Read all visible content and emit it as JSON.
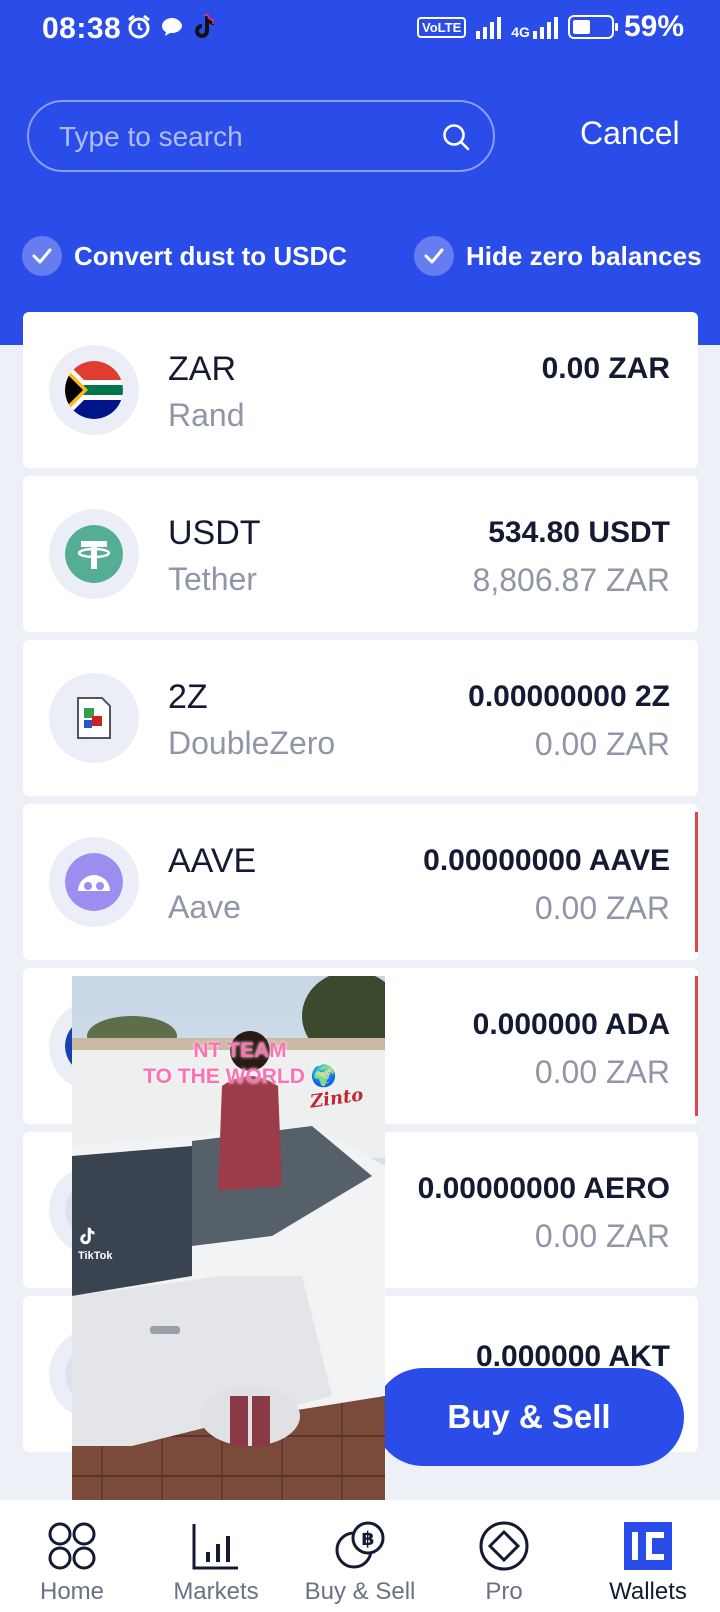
{
  "status_bar": {
    "time": "08:38",
    "volte": "VoLTE",
    "network": "4G",
    "battery_percent": "59%",
    "battery_level": 0.59,
    "left_icons": [
      "alarm-icon",
      "chat-bubble-icon",
      "tiktok-icon"
    ]
  },
  "search": {
    "placeholder": "Type to search",
    "cancel_label": "Cancel"
  },
  "filters": {
    "convert_dust_label": "Convert dust to USDC",
    "hide_zero_label": "Hide zero balances"
  },
  "wallets": [
    {
      "symbol": "ZAR",
      "name": "Rand",
      "amount": "0.00 ZAR",
      "fiat": "",
      "icon": "south-africa-flag-icon"
    },
    {
      "symbol": "USDT",
      "name": "Tether",
      "amount": "534.80 USDT",
      "fiat": "8,806.87 ZAR",
      "icon": "tether-icon"
    },
    {
      "symbol": "2Z",
      "name": "DoubleZero",
      "amount": "0.00000000 2Z",
      "fiat": "0.00 ZAR",
      "icon": "broken-image-icon"
    },
    {
      "symbol": "AAVE",
      "name": "Aave",
      "amount": "0.00000000 AAVE",
      "fiat": "0.00 ZAR",
      "icon": "aave-icon"
    },
    {
      "symbol": "",
      "name": "",
      "amount": "0.000000 ADA",
      "fiat": "0.00 ZAR",
      "icon": "cardano-icon"
    },
    {
      "symbol": "",
      "name": "",
      "amount": "0.00000000 AERO",
      "fiat": "0.00 ZAR",
      "icon": "aero-icon"
    },
    {
      "symbol": "",
      "name": "",
      "amount": "0.000000 AKT",
      "fiat": "",
      "icon": "akash-icon"
    }
  ],
  "fab": {
    "label": "Buy & Sell"
  },
  "overlay": {
    "caption_line1": "NT TEAM",
    "caption_line2": "TO THE WORLD 🌍",
    "watermark_brand": "TikTok",
    "truck_logo": "Zinto"
  },
  "nav": [
    {
      "label": "Home",
      "icon": "home-icon"
    },
    {
      "label": "Markets",
      "icon": "markets-icon"
    },
    {
      "label": "Buy & Sell",
      "icon": "buy-sell-icon"
    },
    {
      "label": "Pro",
      "icon": "pro-icon"
    },
    {
      "label": "Wallets",
      "icon": "wallets-icon",
      "active": true
    }
  ],
  "colors": {
    "brand_blue": "#2a4ce9",
    "tether_green": "#53ae94",
    "aave_purple": "#9b8ef0",
    "alert_red": "#e0434e"
  }
}
